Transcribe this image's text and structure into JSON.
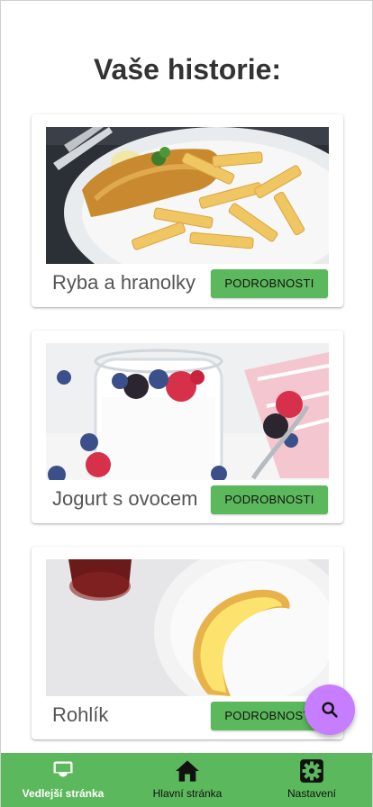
{
  "page": {
    "title": "Vaše historie:"
  },
  "cards": [
    {
      "title": "Ryba a hranolky",
      "button_label": "PODROBNOSTI",
      "image": "fish-and-chips-photo"
    },
    {
      "title": "Jogurt s ovocem",
      "button_label": "PODROBNOSTI",
      "image": "yogurt-with-berries-photo"
    },
    {
      "title": "Rohlík",
      "button_label": "PODROBNOSTI",
      "image": "bread-roll-with-butter-photo"
    }
  ],
  "fab": {
    "icon": "search-icon"
  },
  "bottom_nav": {
    "items": [
      {
        "label": "Vedlejší stránka",
        "icon": "inbox-icon",
        "active": true
      },
      {
        "label": "Hlavní stránka",
        "icon": "home-icon",
        "active": false
      },
      {
        "label": "Nastavení",
        "icon": "settings-icon",
        "active": false
      }
    ]
  },
  "colors": {
    "accent": "#5cb85c",
    "fab": "#c77dff",
    "active_nav_text": "#ffffff"
  }
}
